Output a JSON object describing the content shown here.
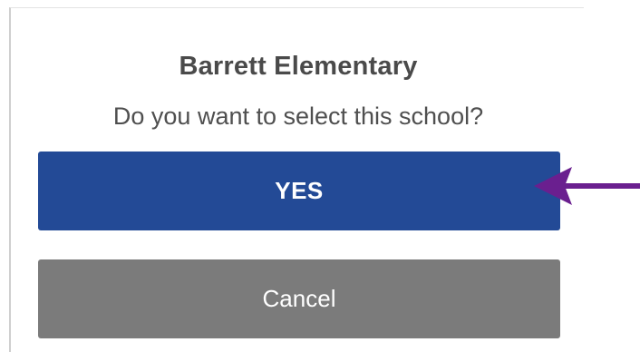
{
  "dialog": {
    "title": "Barrett Elementary",
    "message": "Do you want to select this school?"
  },
  "buttons": {
    "yes_label": "YES",
    "cancel_label": "Cancel"
  },
  "annotation": {
    "icon": "arrow-left-icon"
  },
  "colors": {
    "yes_button": "#234a96",
    "cancel_button": "#7b7b7b",
    "annotation_arrow": "#6a1f8f",
    "title_text": "#4a4a4a",
    "message_text": "#4f4f4f"
  }
}
